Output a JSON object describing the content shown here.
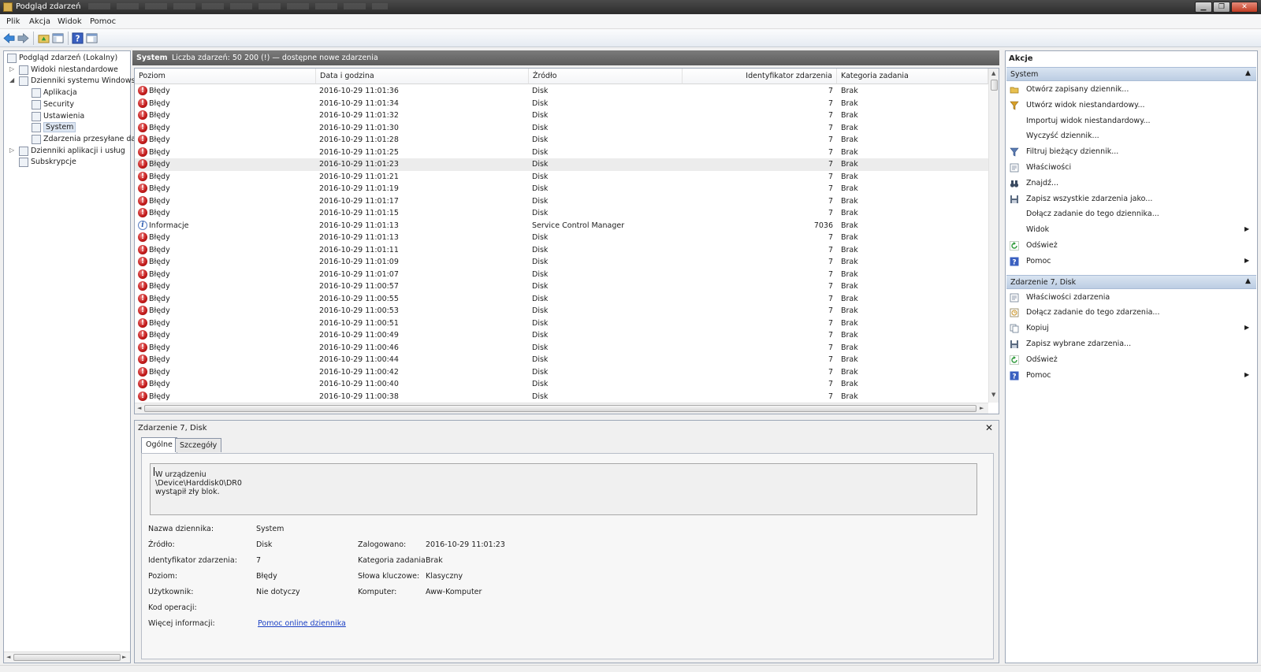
{
  "window": {
    "title": "Podgląd zdarzeń"
  },
  "menu": [
    "Plik",
    "Akcja",
    "Widok",
    "Pomoc"
  ],
  "tree": [
    {
      "label": "Podgląd zdarzeń (Lokalny)",
      "level": 0
    },
    {
      "label": "Widoki niestandardowe",
      "level": 1,
      "arrow": "▷"
    },
    {
      "label": "Dzienniki systemu Windows",
      "level": 1,
      "arrow": "◢"
    },
    {
      "label": "Aplikacja",
      "level": 2
    },
    {
      "label": "Security",
      "level": 2
    },
    {
      "label": "Ustawienia",
      "level": 2
    },
    {
      "label": "System",
      "level": 2,
      "selected": true
    },
    {
      "label": "Zdarzenia przesyłane dalej",
      "level": 2
    },
    {
      "label": "Dzienniki aplikacji i usług",
      "level": 1,
      "arrow": "▷"
    },
    {
      "label": "Subskrypcje",
      "level": 1
    }
  ],
  "center": {
    "log_name": "System",
    "count_text": "Liczba zdarzeń: 50 200 (!) — dostępne nowe zdarzenia"
  },
  "columns": [
    "Poziom",
    "Data i godzina",
    "Źródło",
    "Identyfikator zdarzenia",
    "Kategoria zadania"
  ],
  "events": [
    {
      "level": "Błędy",
      "type": "error",
      "date": "2016-10-29 11:01:36",
      "source": "Disk",
      "id": "7",
      "category": "Brak"
    },
    {
      "level": "Błędy",
      "type": "error",
      "date": "2016-10-29 11:01:34",
      "source": "Disk",
      "id": "7",
      "category": "Brak"
    },
    {
      "level": "Błędy",
      "type": "error",
      "date": "2016-10-29 11:01:32",
      "source": "Disk",
      "id": "7",
      "category": "Brak"
    },
    {
      "level": "Błędy",
      "type": "error",
      "date": "2016-10-29 11:01:30",
      "source": "Disk",
      "id": "7",
      "category": "Brak"
    },
    {
      "level": "Błędy",
      "type": "error",
      "date": "2016-10-29 11:01:28",
      "source": "Disk",
      "id": "7",
      "category": "Brak"
    },
    {
      "level": "Błędy",
      "type": "error",
      "date": "2016-10-29 11:01:25",
      "source": "Disk",
      "id": "7",
      "category": "Brak"
    },
    {
      "level": "Błędy",
      "type": "error",
      "date": "2016-10-29 11:01:23",
      "source": "Disk",
      "id": "7",
      "category": "Brak",
      "selected": true
    },
    {
      "level": "Błędy",
      "type": "error",
      "date": "2016-10-29 11:01:21",
      "source": "Disk",
      "id": "7",
      "category": "Brak"
    },
    {
      "level": "Błędy",
      "type": "error",
      "date": "2016-10-29 11:01:19",
      "source": "Disk",
      "id": "7",
      "category": "Brak"
    },
    {
      "level": "Błędy",
      "type": "error",
      "date": "2016-10-29 11:01:17",
      "source": "Disk",
      "id": "7",
      "category": "Brak"
    },
    {
      "level": "Błędy",
      "type": "error",
      "date": "2016-10-29 11:01:15",
      "source": "Disk",
      "id": "7",
      "category": "Brak"
    },
    {
      "level": "Informacje",
      "type": "info",
      "date": "2016-10-29 11:01:13",
      "source": "Service Control Manager",
      "id": "7036",
      "category": "Brak"
    },
    {
      "level": "Błędy",
      "type": "error",
      "date": "2016-10-29 11:01:13",
      "source": "Disk",
      "id": "7",
      "category": "Brak"
    },
    {
      "level": "Błędy",
      "type": "error",
      "date": "2016-10-29 11:01:11",
      "source": "Disk",
      "id": "7",
      "category": "Brak"
    },
    {
      "level": "Błędy",
      "type": "error",
      "date": "2016-10-29 11:01:09",
      "source": "Disk",
      "id": "7",
      "category": "Brak"
    },
    {
      "level": "Błędy",
      "type": "error",
      "date": "2016-10-29 11:01:07",
      "source": "Disk",
      "id": "7",
      "category": "Brak"
    },
    {
      "level": "Błędy",
      "type": "error",
      "date": "2016-10-29 11:00:57",
      "source": "Disk",
      "id": "7",
      "category": "Brak"
    },
    {
      "level": "Błędy",
      "type": "error",
      "date": "2016-10-29 11:00:55",
      "source": "Disk",
      "id": "7",
      "category": "Brak"
    },
    {
      "level": "Błędy",
      "type": "error",
      "date": "2016-10-29 11:00:53",
      "source": "Disk",
      "id": "7",
      "category": "Brak"
    },
    {
      "level": "Błędy",
      "type": "error",
      "date": "2016-10-29 11:00:51",
      "source": "Disk",
      "id": "7",
      "category": "Brak"
    },
    {
      "level": "Błędy",
      "type": "error",
      "date": "2016-10-29 11:00:49",
      "source": "Disk",
      "id": "7",
      "category": "Brak"
    },
    {
      "level": "Błędy",
      "type": "error",
      "date": "2016-10-29 11:00:46",
      "source": "Disk",
      "id": "7",
      "category": "Brak"
    },
    {
      "level": "Błędy",
      "type": "error",
      "date": "2016-10-29 11:00:44",
      "source": "Disk",
      "id": "7",
      "category": "Brak"
    },
    {
      "level": "Błędy",
      "type": "error",
      "date": "2016-10-29 11:00:42",
      "source": "Disk",
      "id": "7",
      "category": "Brak"
    },
    {
      "level": "Błędy",
      "type": "error",
      "date": "2016-10-29 11:00:40",
      "source": "Disk",
      "id": "7",
      "category": "Brak"
    },
    {
      "level": "Błędy",
      "type": "error",
      "date": "2016-10-29 11:00:38",
      "source": "Disk",
      "id": "7",
      "category": "Brak"
    }
  ],
  "detail": {
    "title": "Zdarzenie 7, Disk",
    "tabs": [
      "Ogólne",
      "Szczegóły"
    ],
    "description": "W urządzeniu \\Device\\Harddisk0\\DR0 wystąpił zły blok.",
    "labels": {
      "log_name": "Nazwa dziennika:",
      "source": "Źródło:",
      "event_id": "Identyfikator zdarzenia:",
      "level": "Poziom:",
      "user": "Użytkownik:",
      "opcode": "Kod operacji:",
      "more_info": "Więcej informacji:",
      "logged": "Zalogowano:",
      "task_category": "Kategoria zadania:",
      "keywords": "Słowa kluczowe:",
      "computer": "Komputer:"
    },
    "values": {
      "log_name": "System",
      "source": "Disk",
      "event_id": "7",
      "level": "Błędy",
      "user": "Nie dotyczy",
      "more_info_link": "Pomoc online dziennika",
      "logged": "2016-10-29 11:01:23",
      "task_category": "Brak",
      "keywords": "Klasyczny",
      "computer": "Aww-Komputer"
    }
  },
  "actions": {
    "title": "Akcje",
    "sections": [
      {
        "header": "System",
        "items": [
          {
            "label": "Otwórz zapisany dziennik...",
            "icon": "folder-open-icon"
          },
          {
            "label": "Utwórz widok niestandardowy...",
            "icon": "funnel-icon"
          },
          {
            "label": "Importuj widok niestandardowy...",
            "icon": ""
          },
          {
            "label": "Wyczyść dziennik...",
            "icon": ""
          },
          {
            "label": "Filtruj bieżący dziennik...",
            "icon": "filter-icon"
          },
          {
            "label": "Właściwości",
            "icon": "properties-icon"
          },
          {
            "label": "Znajdź...",
            "icon": "binoculars-icon"
          },
          {
            "label": "Zapisz wszystkie zdarzenia jako...",
            "icon": "save-icon"
          },
          {
            "label": "Dołącz zadanie do tego dziennika...",
            "icon": ""
          },
          {
            "label": "Widok",
            "icon": "",
            "submenu": true
          },
          {
            "label": "Odśwież",
            "icon": "refresh-icon"
          },
          {
            "label": "Pomoc",
            "icon": "help-icon",
            "submenu": true
          }
        ]
      },
      {
        "header": "Zdarzenie 7, Disk",
        "items": [
          {
            "label": "Właściwości zdarzenia",
            "icon": "event-properties-icon"
          },
          {
            "label": "Dołącz zadanie do tego zdarzenia...",
            "icon": "task-icon"
          },
          {
            "label": "Kopiuj",
            "icon": "copy-icon",
            "submenu": true
          },
          {
            "label": "Zapisz wybrane zdarzenia...",
            "icon": "save-icon"
          },
          {
            "label": "Odśwież",
            "icon": "refresh-icon"
          },
          {
            "label": "Pomoc",
            "icon": "help-icon",
            "submenu": true
          }
        ]
      }
    ]
  },
  "colors": {
    "error": "#c01818",
    "selection": "#ececec",
    "link": "#1a3fc4",
    "section_header": "#c9d8ea"
  }
}
